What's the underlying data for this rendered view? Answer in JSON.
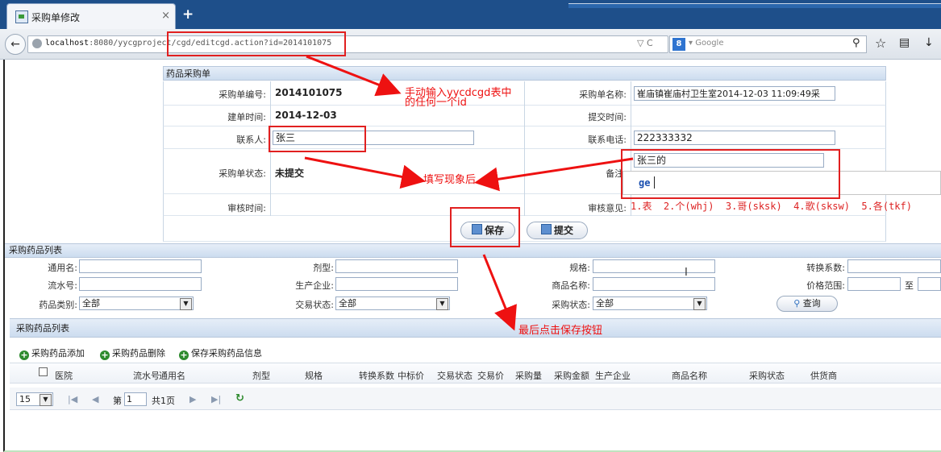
{
  "browser": {
    "tab_title": "采购单修改",
    "tab_close": "×",
    "new_tab": "+",
    "url_host": "localhost",
    "url_rest": ":8080/yycgproject/cgd/editcgd.action?id=2014101075",
    "search_engine": "8",
    "search_placeholder": "Google"
  },
  "form": {
    "header": "药品采购单",
    "id_label": "采购单编号:",
    "id_value": "2014101075",
    "name_label": "采购单名称:",
    "name_value": "崔庙镇崔庙村卫生室2014-12-03 11:09:49采",
    "created_label": "建单时间:",
    "created_value": "2014-12-03",
    "submitted_label": "提交时间:",
    "contact_label": "联系人:",
    "contact_value": "张三",
    "phone_label": "联系电话:",
    "phone_value": "222333332",
    "status_label": "采购单状态:",
    "status_value": "未提交",
    "remark_label": "备注:",
    "remark_value": "张三的",
    "audit_time_label": "审核时间:",
    "audit_opinion_label": "审核意见:",
    "save_label": "保存",
    "submit_label": "提交"
  },
  "ime": {
    "input": "ge",
    "candidates": "1.表  2.个(whj)  3.哥(sksk)  4.歌(sksw)  5.各(tkf)"
  },
  "annotations": {
    "a1_line1": "手动输入yycdcgd表中",
    "a1_line2": "的任何一个id",
    "a2": "填写现象后",
    "a3": "最后点击保存按钮"
  },
  "query": {
    "header": "采购药品列表",
    "generic_name": "通用名:",
    "dosage_form": "剂型:",
    "spec": "规格:",
    "conversion": "转换系数:",
    "serial_no": "流水号:",
    "manufacturer": "生产企业:",
    "product_name": "商品名称:",
    "price_range": "价格范围:",
    "price_to": "至",
    "category": "药品类别:",
    "category_value": "全部",
    "trade_status": "交易状态:",
    "trade_status_value": "全部",
    "purchase_status": "采购状态:",
    "purchase_status_value": "全部",
    "query_button": "查询"
  },
  "grid": {
    "header": "采购药品列表",
    "toolbar": [
      "采购药品添加",
      "采购药品删除",
      "保存采购药品信息"
    ],
    "columns": [
      "医院",
      "流水号",
      "通用名",
      "剂型",
      "规格",
      "转换系数",
      "中标价",
      "交易状态",
      "交易价",
      "采购量",
      "采购金额",
      "生产企业",
      "商品名称",
      "采购状态",
      "供货商"
    ],
    "page_size": "15",
    "page_prefix": "第",
    "page_no": "1",
    "page_total": "共1页"
  }
}
